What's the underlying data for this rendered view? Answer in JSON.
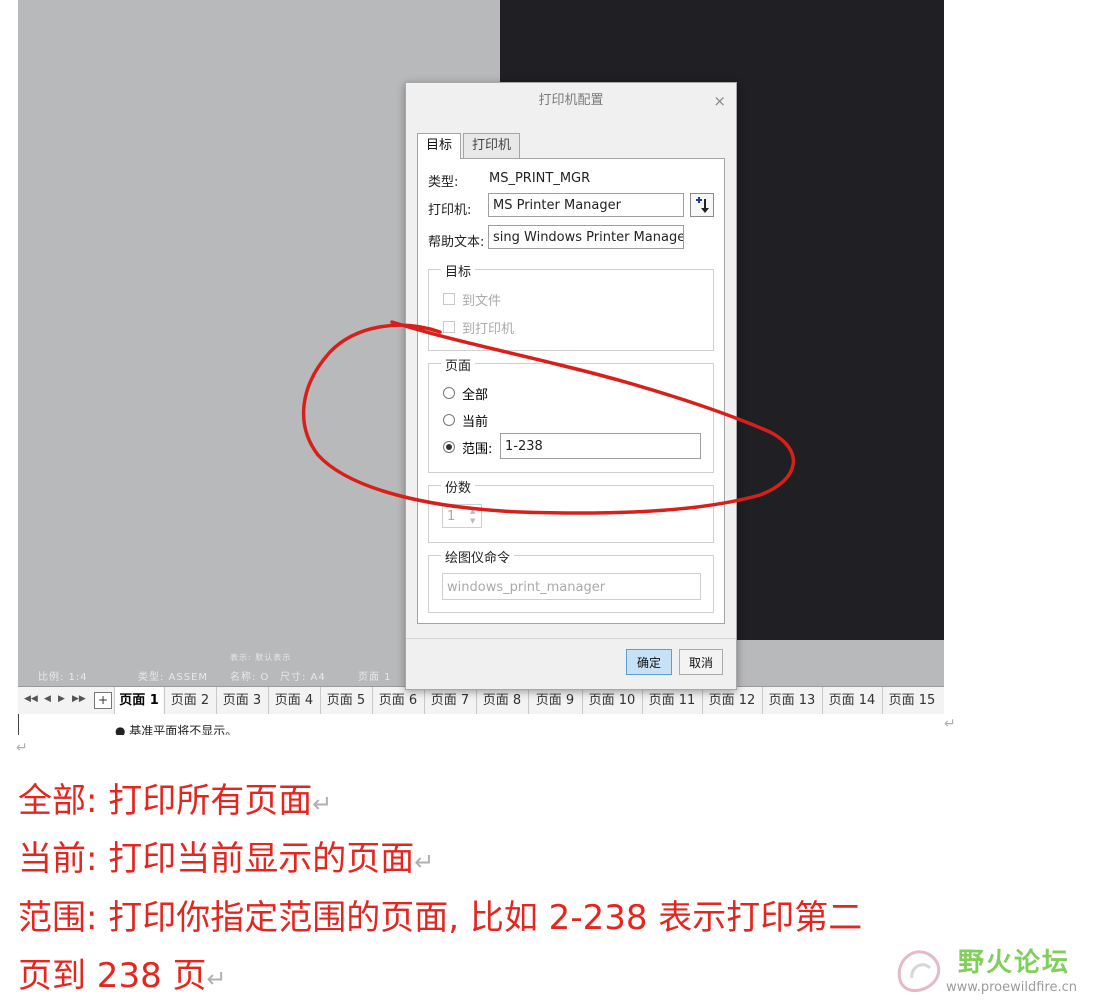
{
  "status_bar": {
    "scale": "比例: 1:4",
    "type": "类型: ASSEM",
    "name": "名称: O",
    "size": "尺寸: A4",
    "page": "页面 1",
    "display": "表示: 默认表示"
  },
  "dialog": {
    "title": "打印机配置",
    "close": "×",
    "tabs": [
      "目标",
      "打印机"
    ],
    "type_label": "类型:",
    "type_value": "MS_PRINT_MGR",
    "printer_label": "打印机:",
    "printer_value": "MS Printer Manager",
    "help_label": "帮助文本:",
    "help_value": "sing Windows Printer Manager.",
    "group_target": {
      "title": "目标",
      "to_file": "到文件",
      "to_printer": "到打印机"
    },
    "group_pages": {
      "title": "页面",
      "all": "全部",
      "current": "当前",
      "range_label": "范围:",
      "range_value": "1-238"
    },
    "group_copies": {
      "title": "份数",
      "value": "1"
    },
    "group_plotter": {
      "title": "绘图仪命令",
      "value": "windows_print_manager"
    },
    "ok": "确定",
    "cancel": "取消"
  },
  "page_tabs": [
    "页面 1",
    "页面 2",
    "页面 3",
    "页面 4",
    "页面 5",
    "页面 6",
    "页面 7",
    "页面 8",
    "页面 9",
    "页面 10",
    "页面 11",
    "页面 12",
    "页面 13",
    "页面 14",
    "页面 15"
  ],
  "active_page_tab": "页面 1",
  "doc_bullet": "基准平面将不显示。",
  "explanations": [
    "全部:  打印所有页面",
    "当前: 打印当前显示的页面",
    "范围:  打印你指定范围的页面, 比如 2-238   表示打印第二",
    "页到 238 页"
  ],
  "return_mark": "↵",
  "watermark": {
    "name": "野火论坛",
    "url": "www.proewildfire.cn"
  },
  "colors": {
    "annotation_red": "#e3261f",
    "watermark_green": "#7fcf5a",
    "ok_button_blue": "#c7e1f7"
  }
}
